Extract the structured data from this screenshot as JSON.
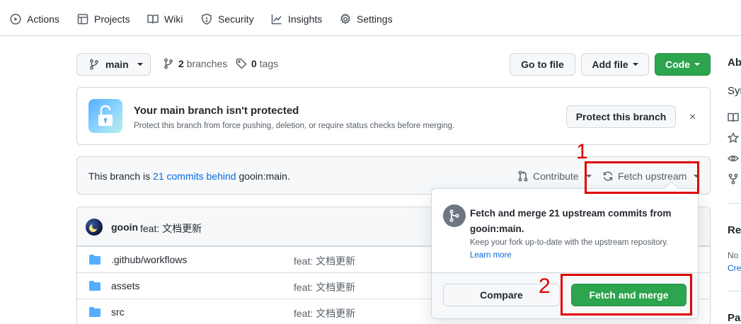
{
  "nav": {
    "items": [
      {
        "label": "Actions",
        "icon": "play-circle-icon"
      },
      {
        "label": "Projects",
        "icon": "table-icon"
      },
      {
        "label": "Wiki",
        "icon": "book-icon"
      },
      {
        "label": "Security",
        "icon": "shield-icon"
      },
      {
        "label": "Insights",
        "icon": "graph-icon"
      },
      {
        "label": "Settings",
        "icon": "gear-icon"
      }
    ]
  },
  "repo": {
    "branch": "main",
    "branches_count": "2",
    "branches_label": "branches",
    "tags_count": "0",
    "tags_label": "tags",
    "goto_file": "Go to file",
    "add_file": "Add file",
    "code": "Code"
  },
  "protection": {
    "title": "Your main branch isn't protected",
    "description": "Protect this branch from force pushing, deletion, or require status checks before merging.",
    "button": "Protect this branch",
    "close": "×"
  },
  "behind": {
    "prefix": "This branch is",
    "link": "21 commits behind",
    "suffix": "gooin:main.",
    "contribute": "Contribute",
    "fetch_upstream": "Fetch upstream"
  },
  "commit": {
    "author": "gooin",
    "message": "feat: 文档更新"
  },
  "files": [
    {
      "name": ".github/workflows",
      "message": "feat: 文档更新"
    },
    {
      "name": "assets",
      "message": "feat: 文档更新"
    },
    {
      "name": "src",
      "message": "feat: 文档更新"
    }
  ],
  "sidebar": {
    "about": "Ab",
    "desc": "Syn",
    "releases": "Rel",
    "no_releases": "No",
    "create": "Crea",
    "packages": "Pac"
  },
  "popover": {
    "title": "Fetch and merge 21 upstream commits from gooin:main.",
    "description": "Keep your fork up-to-date with the upstream repository.",
    "learn_more": "Learn more",
    "compare": "Compare",
    "fetch_merge": "Fetch and merge"
  },
  "annotations": {
    "one": "1",
    "two": "2"
  },
  "colors": {
    "accent_blue": "#0969da",
    "green": "#2da44e",
    "annotation_red": "#e00000"
  }
}
